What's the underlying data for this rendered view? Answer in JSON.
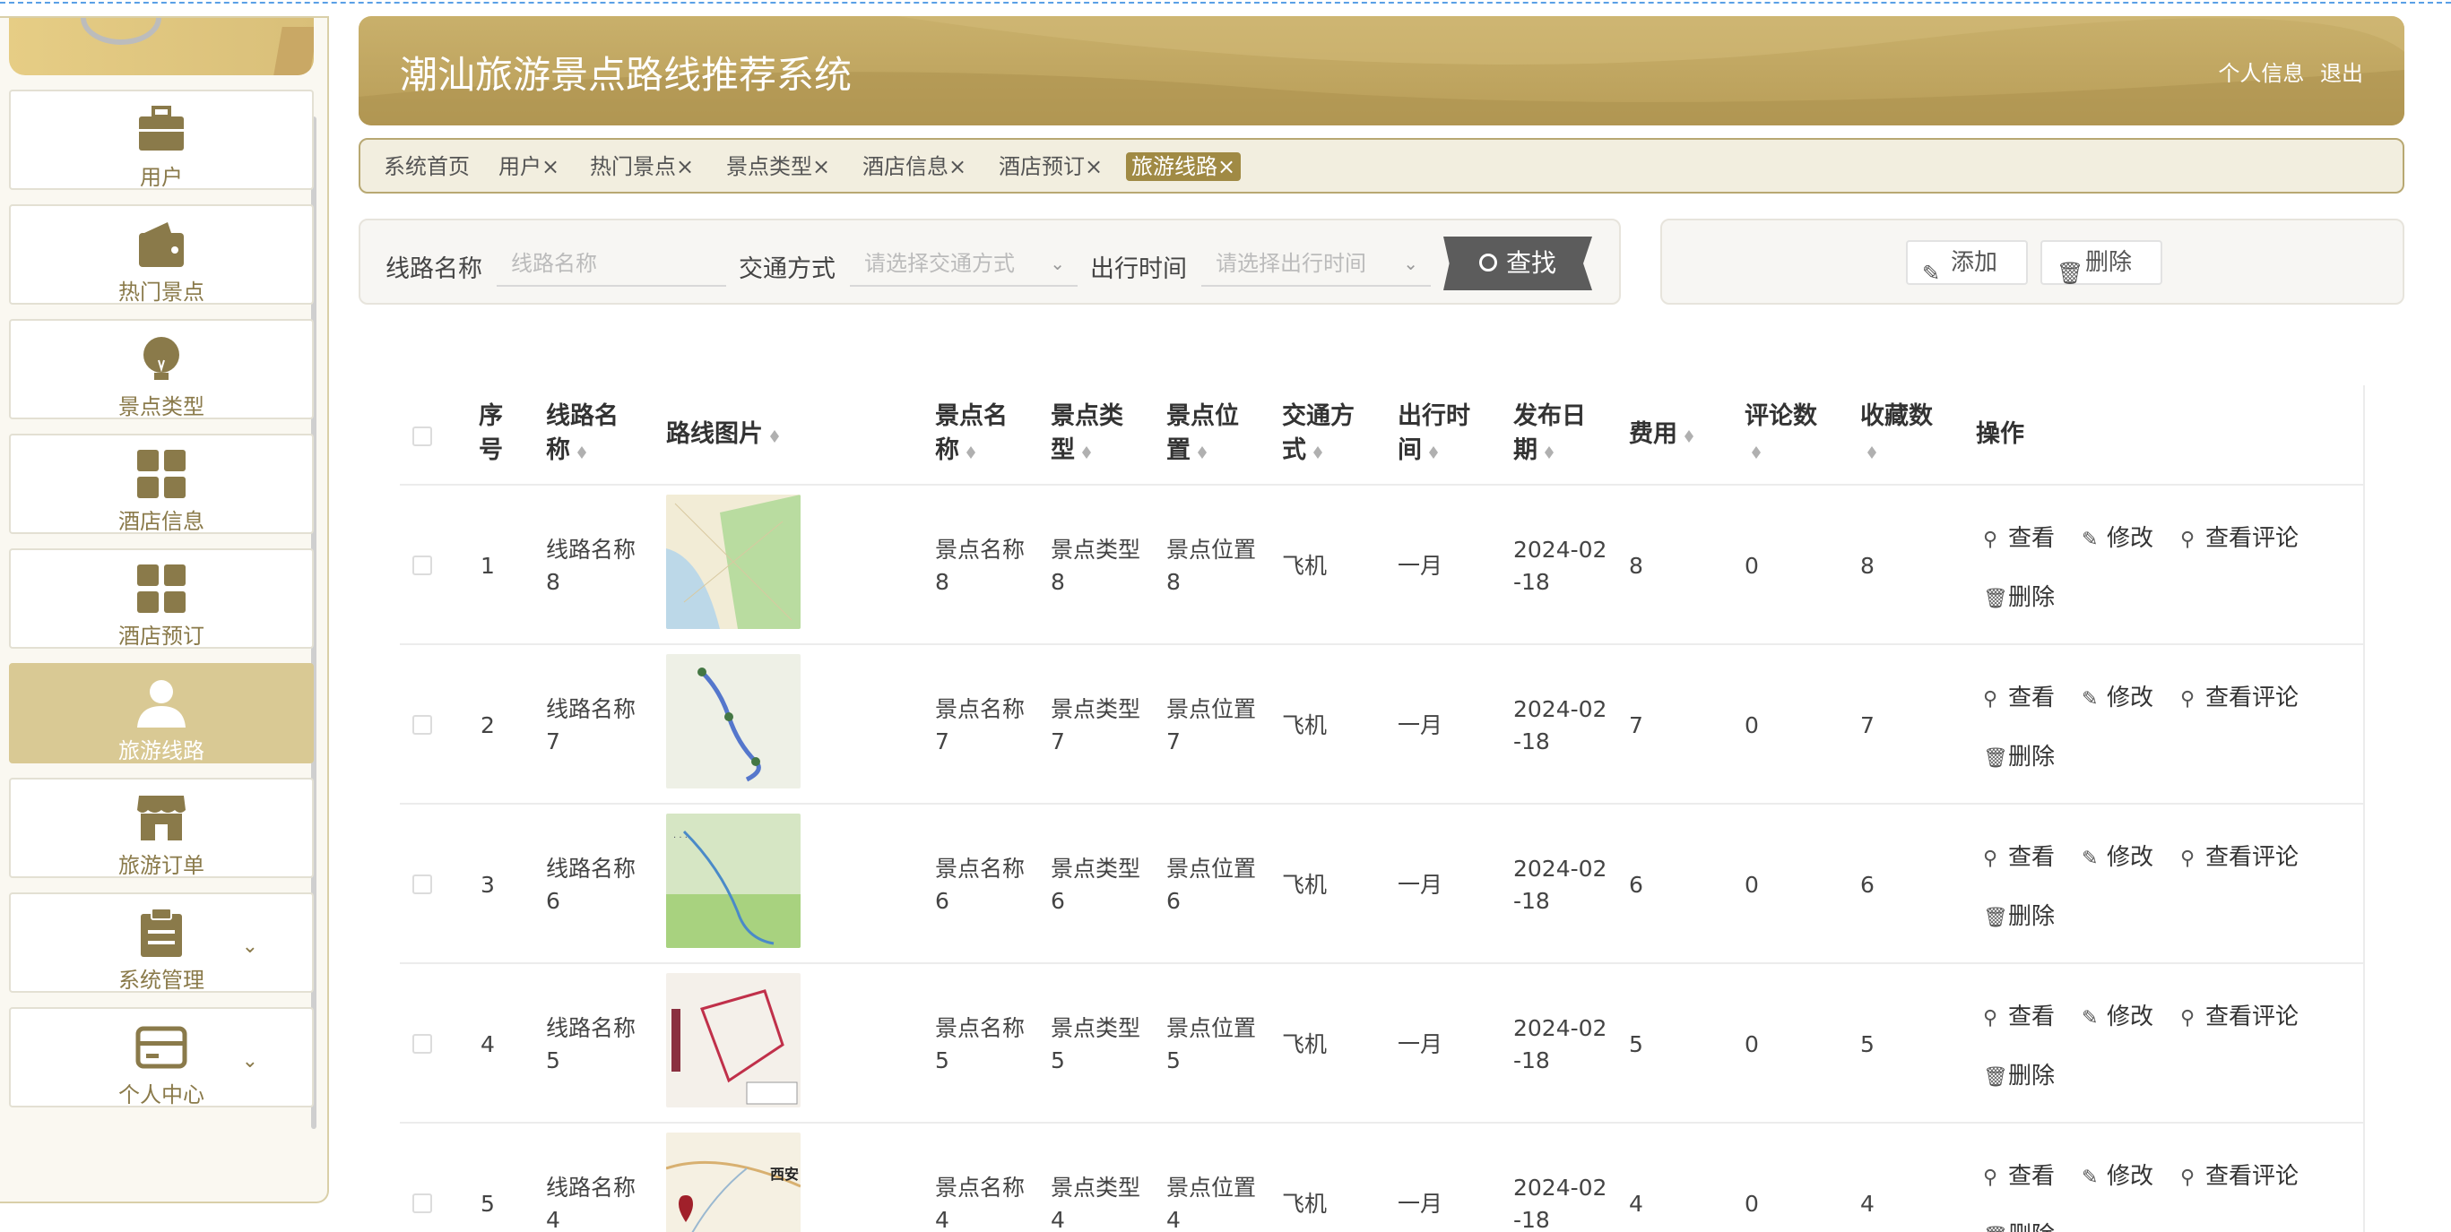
{
  "app": {
    "title": "潮汕旅游景点路线推荐系统",
    "profile_link": "个人信息",
    "logout_link": "退出"
  },
  "sidebar": {
    "items": [
      {
        "label": "用户",
        "icon": "briefcase-icon"
      },
      {
        "label": "热门景点",
        "icon": "wallet-icon"
      },
      {
        "label": "景点类型",
        "icon": "bulb-icon"
      },
      {
        "label": "酒店信息",
        "icon": "grid-icon"
      },
      {
        "label": "酒店预订",
        "icon": "grid-icon"
      },
      {
        "label": "旅游线路",
        "icon": "user-icon",
        "active": true
      },
      {
        "label": "旅游订单",
        "icon": "shop-icon"
      },
      {
        "label": "系统管理",
        "icon": "clipboard-icon",
        "expand": "⌄"
      },
      {
        "label": "个人中心",
        "icon": "card-icon",
        "expand": "⌄"
      }
    ]
  },
  "tags": [
    "系统首页",
    "用户×",
    "热门景点×",
    "景点类型×",
    "酒店信息×",
    "酒店预订×",
    "旅游线路×"
  ],
  "search": {
    "route_name_label": "线路名称",
    "route_name_placeholder": "线路名称",
    "transport_label": "交通方式",
    "transport_placeholder": "请选择交通方式",
    "time_label": "出行时间",
    "time_placeholder": "请选择出行时间",
    "search_button": "查找"
  },
  "actions": {
    "add": "添加",
    "delete": "删除"
  },
  "table": {
    "headers": {
      "seq": [
        "序",
        "号"
      ],
      "route_name": [
        "线路名",
        "称"
      ],
      "route_img": "路线图片",
      "spot_name": [
        "景点名",
        "称"
      ],
      "spot_type": [
        "景点类",
        "型"
      ],
      "spot_loc": [
        "景点位",
        "置"
      ],
      "transport": [
        "交通方",
        "式"
      ],
      "travel_time": [
        "出行时",
        "间"
      ],
      "publish_date": [
        "发布日",
        "期"
      ],
      "fee": "费用",
      "comments": "评论数",
      "favorites": "收藏数",
      "ops": "操作"
    },
    "op_labels": {
      "view": "查看",
      "edit": "修改",
      "view_comments": "查看评论",
      "delete": "删除"
    },
    "rows": [
      {
        "seq": "1",
        "route_a": "线路名称",
        "route_b": "8",
        "spot_a": "景点名称",
        "spot_b": "8",
        "type_a": "景点类型",
        "type_b": "8",
        "loc_a": "景点位置",
        "loc_b": "8",
        "transport": "飞机",
        "time": "一月",
        "date_a": "2024-02",
        "date_b": "-18",
        "fee": "8",
        "comments": "0",
        "favorites": "8",
        "map": "map1"
      },
      {
        "seq": "2",
        "route_a": "线路名称",
        "route_b": "7",
        "spot_a": "景点名称",
        "spot_b": "7",
        "type_a": "景点类型",
        "type_b": "7",
        "loc_a": "景点位置",
        "loc_b": "7",
        "transport": "飞机",
        "time": "一月",
        "date_a": "2024-02",
        "date_b": "-18",
        "fee": "7",
        "comments": "0",
        "favorites": "7",
        "map": "map2"
      },
      {
        "seq": "3",
        "route_a": "线路名称",
        "route_b": "6",
        "spot_a": "景点名称",
        "spot_b": "6",
        "type_a": "景点类型",
        "type_b": "6",
        "loc_a": "景点位置",
        "loc_b": "6",
        "transport": "飞机",
        "time": "一月",
        "date_a": "2024-02",
        "date_b": "-18",
        "fee": "6",
        "comments": "0",
        "favorites": "6",
        "map": "map3"
      },
      {
        "seq": "4",
        "route_a": "线路名称",
        "route_b": "5",
        "spot_a": "景点名称",
        "spot_b": "5",
        "type_a": "景点类型",
        "type_b": "5",
        "loc_a": "景点位置",
        "loc_b": "5",
        "transport": "飞机",
        "time": "一月",
        "date_a": "2024-02",
        "date_b": "-18",
        "fee": "5",
        "comments": "0",
        "favorites": "5",
        "map": "map4"
      },
      {
        "seq": "5",
        "route_a": "线路名称",
        "route_b": "4",
        "spot_a": "景点名称",
        "spot_b": "4",
        "type_a": "景点类型",
        "type_b": "4",
        "loc_a": "景点位置",
        "loc_b": "4",
        "transport": "飞机",
        "time": "一月",
        "date_a": "2024-02",
        "date_b": "-18",
        "fee": "4",
        "comments": "0",
        "favorites": "4",
        "map": "map5",
        "map_label": "西安"
      }
    ]
  },
  "colors": {
    "accent": "#b89d58",
    "active_nav": "#d9c994",
    "tag_active": "#a08a44",
    "search_button": "#5c5c5c"
  }
}
